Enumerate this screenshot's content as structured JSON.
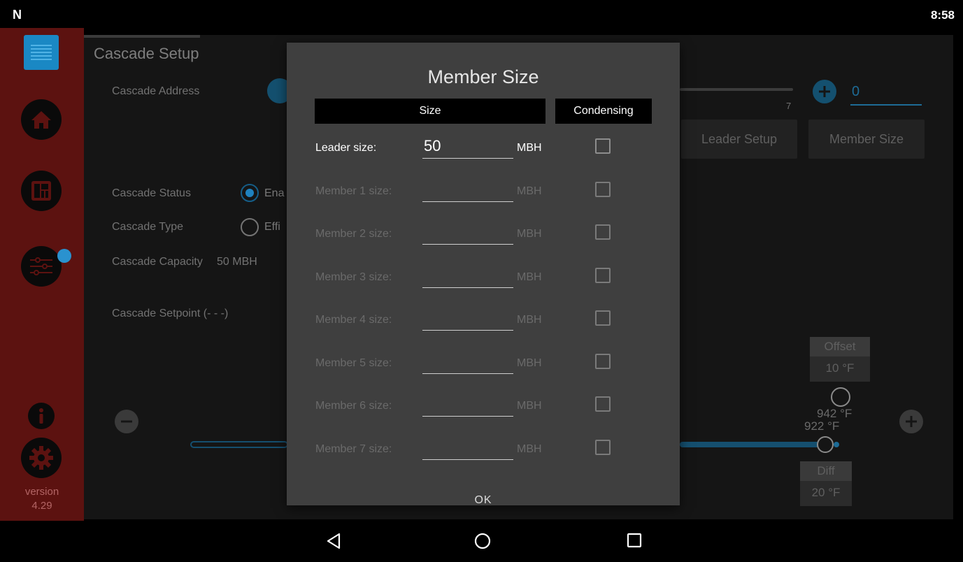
{
  "status_bar": {
    "logo": "N",
    "time": "8:58"
  },
  "sidebar": {
    "version_label": "version",
    "version_number": "4.29"
  },
  "background": {
    "title": "Cascade Setup",
    "cascade_address_label": "Cascade Address",
    "cascade_address_value": "0",
    "slider_max_label": "7",
    "leader_setup_button": "Leader Setup",
    "member_size_button": "Member Size",
    "cascade_status_label": "Cascade Status",
    "cascade_status_option": "Ena",
    "cascade_type_label": "Cascade Type",
    "cascade_type_option": "Effi",
    "cascade_capacity_label": "Cascade Capacity",
    "cascade_capacity_value": "50 MBH",
    "cascade_setpoint_label": "Cascade Setpoint (- - -)",
    "offset_label": "Offset",
    "offset_value": "10 °F",
    "diff_label": "Diff",
    "diff_value": "20 °F",
    "upper_temp": "942 °F",
    "lower_temp": "922 °F"
  },
  "dialog": {
    "title": "Member Size",
    "col_size": "Size",
    "col_condensing": "Condensing",
    "rows": [
      {
        "label": "Leader size:",
        "value": "50",
        "unit": "MBH",
        "enabled": true,
        "condensing": false
      },
      {
        "label": "Member 1 size:",
        "value": "",
        "unit": "MBH",
        "enabled": false,
        "condensing": false
      },
      {
        "label": "Member 2 size:",
        "value": "",
        "unit": "MBH",
        "enabled": false,
        "condensing": false
      },
      {
        "label": "Member 3 size:",
        "value": "",
        "unit": "MBH",
        "enabled": false,
        "condensing": false
      },
      {
        "label": "Member 4 size:",
        "value": "",
        "unit": "MBH",
        "enabled": false,
        "condensing": false
      },
      {
        "label": "Member 5 size:",
        "value": "",
        "unit": "MBH",
        "enabled": false,
        "condensing": false
      },
      {
        "label": "Member 6 size:",
        "value": "",
        "unit": "MBH",
        "enabled": false,
        "condensing": false
      },
      {
        "label": "Member 7 size:",
        "value": "",
        "unit": "MBH",
        "enabled": false,
        "condensing": false
      }
    ],
    "ok_label": "OK"
  },
  "colors": {
    "sidebar": "#5c1210",
    "accent_blue": "#1f82bf",
    "dialog_bg": "#3f3f3f"
  }
}
